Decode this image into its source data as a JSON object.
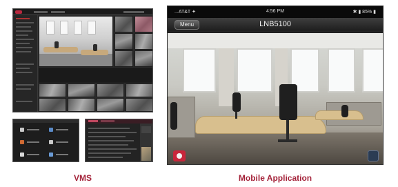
{
  "captions": {
    "vms": "VMS",
    "mobile": "Mobile Application"
  },
  "mobile_app": {
    "status_bar": {
      "carrier": "...AT&T ✦",
      "time": "4:56 PM",
      "battery": "✱ ▮ 85% ▮"
    },
    "menu_label": "Menu",
    "camera_title": "LNB5100"
  },
  "colors": {
    "caption": "#a4233a",
    "brand_red": "#b8283e"
  },
  "icons": {
    "record": "record-icon",
    "settings": "settings-icon"
  }
}
